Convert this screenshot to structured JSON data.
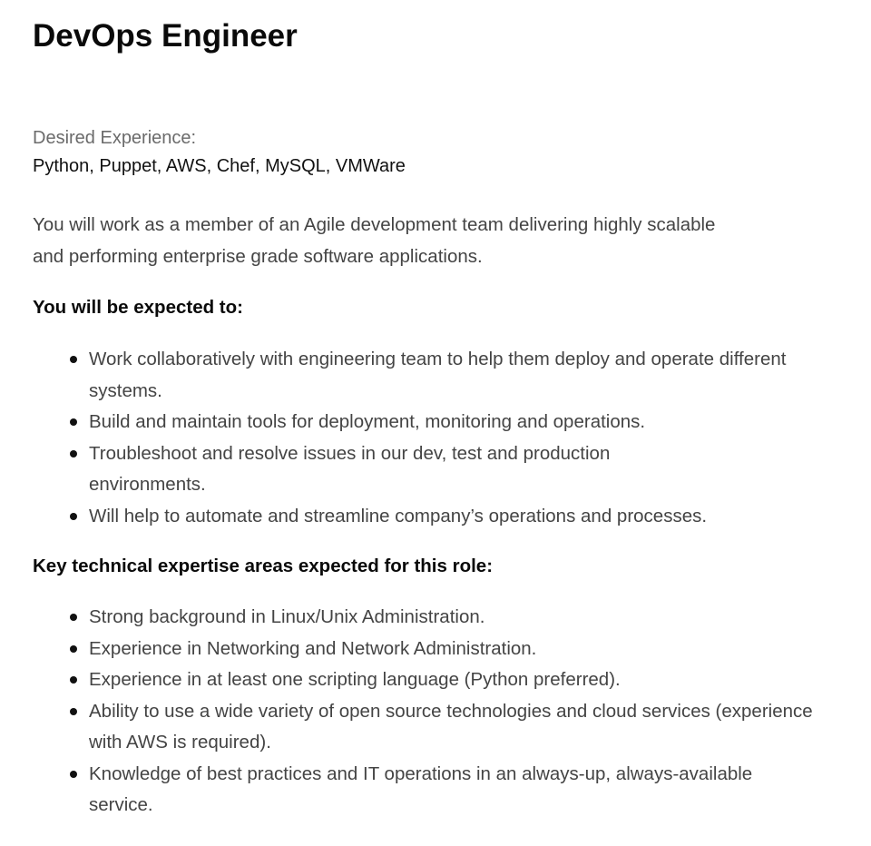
{
  "title": "DevOps Engineer",
  "experience": {
    "label": "Desired Experience:",
    "value": "Python, Puppet, AWS, Chef, MySQL, VMWare"
  },
  "intro": "You will work as a member of an Agile development team delivering highly scalable and performing enterprise grade software applications.",
  "expectations": {
    "heading": "You will be expected to:",
    "items": [
      "Work collaboratively with engineering team to help them deploy and operate different systems.",
      "Build and maintain tools for deployment, monitoring and operations.",
      "Troubleshoot and resolve issues in our dev, test and production environments.",
      "Will help to automate and streamline company’s operations and processes."
    ]
  },
  "expertise": {
    "heading": "Key technical expertise areas expected for this role:",
    "items": [
      "Strong background in Linux/Unix Administration.",
      "Experience in Networking and Network Administration.",
      "Experience in at least one scripting language (Python preferred).",
      "Ability to use a wide variety of open source technologies and cloud services (experience with AWS is required).",
      "Knowledge of best practices and IT operations in an always-up, always-available service."
    ]
  }
}
